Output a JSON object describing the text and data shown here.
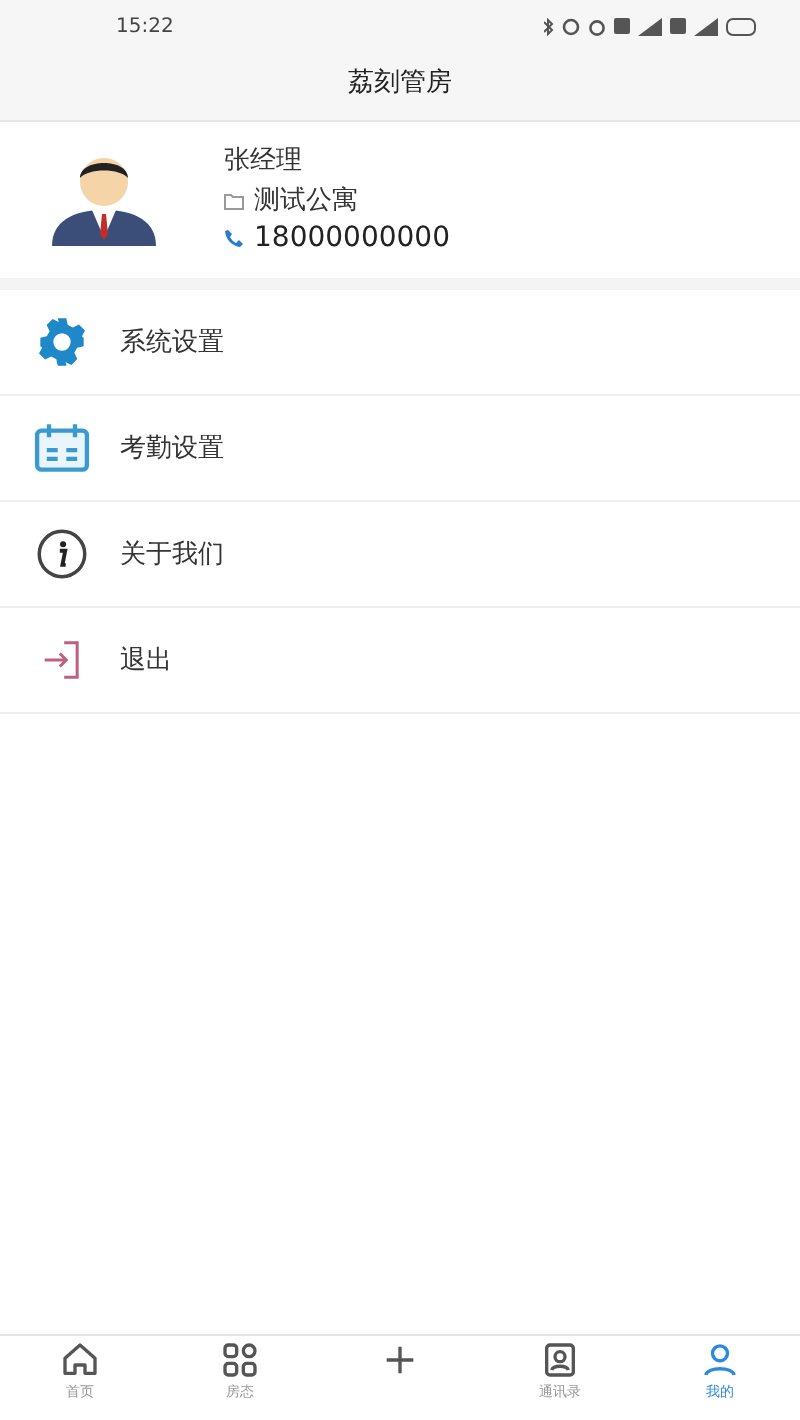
{
  "status_bar": {
    "time": "15:22"
  },
  "header": {
    "title": "荔刻管房"
  },
  "profile": {
    "name": "张经理",
    "apartment": "测试公寓",
    "phone": "18000000000"
  },
  "menu": [
    {
      "kind": "gear",
      "label": "系统设置"
    },
    {
      "kind": "calendar",
      "label": "考勤设置"
    },
    {
      "kind": "info",
      "label": "关于我们"
    },
    {
      "kind": "logout",
      "label": "退出"
    }
  ],
  "tabs": [
    {
      "kind": "home",
      "label": "首页",
      "selected": false
    },
    {
      "kind": "grid",
      "label": "房态",
      "selected": false
    },
    {
      "kind": "add",
      "selected": false
    },
    {
      "kind": "contacts",
      "label": "通讯录",
      "selected": false
    },
    {
      "kind": "user",
      "label": "我的",
      "selected": true
    }
  ]
}
